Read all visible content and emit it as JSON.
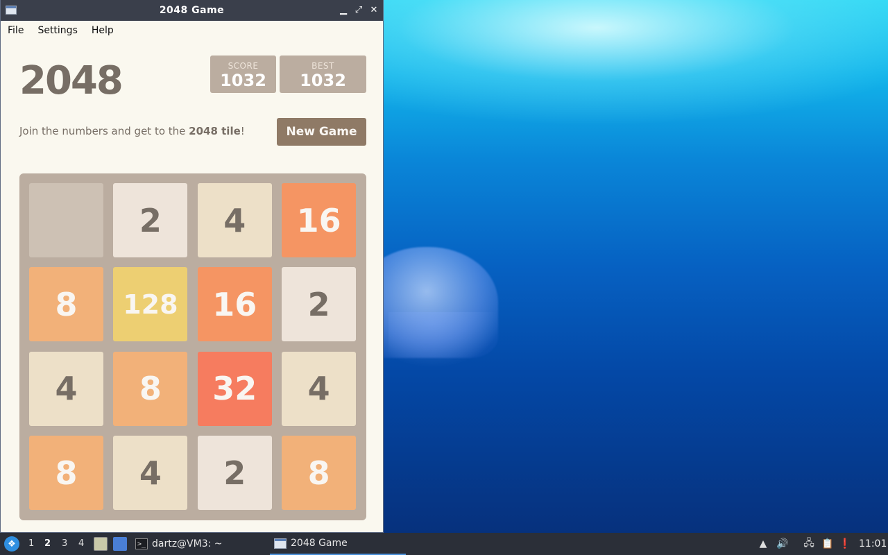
{
  "window": {
    "title": "2048 Game",
    "controls": {
      "minimize": "▁",
      "maximize": "⤢",
      "close": "✕"
    }
  },
  "menu": {
    "items": [
      "File",
      "Settings",
      "Help"
    ]
  },
  "game": {
    "title": "2048",
    "score_label": "SCORE",
    "score_value": "1032",
    "best_label": "BEST",
    "best_value": "1032",
    "subtitle_pre": "Join the numbers and get to the ",
    "subtitle_bold": "2048 tile",
    "subtitle_post": "!",
    "new_game_label": "New Game",
    "board": [
      [
        "",
        "2",
        "4",
        "16"
      ],
      [
        "8",
        "128",
        "16",
        "2"
      ],
      [
        "4",
        "8",
        "32",
        "4"
      ],
      [
        "8",
        "4",
        "2",
        "8"
      ]
    ]
  },
  "taskbar": {
    "workspaces": [
      "1",
      "2",
      "3",
      "4"
    ],
    "active_workspace": "2",
    "tasks": [
      {
        "label": "dartz@VM3: ~",
        "icon": "terminal-icon"
      },
      {
        "label": "2048 Game",
        "icon": "window-icon"
      }
    ],
    "clock": "11:01"
  },
  "colors": {
    "tile_text_dark": "#776e65",
    "board_bg": "#bbada0",
    "new_game_bg": "#8f7a66"
  }
}
